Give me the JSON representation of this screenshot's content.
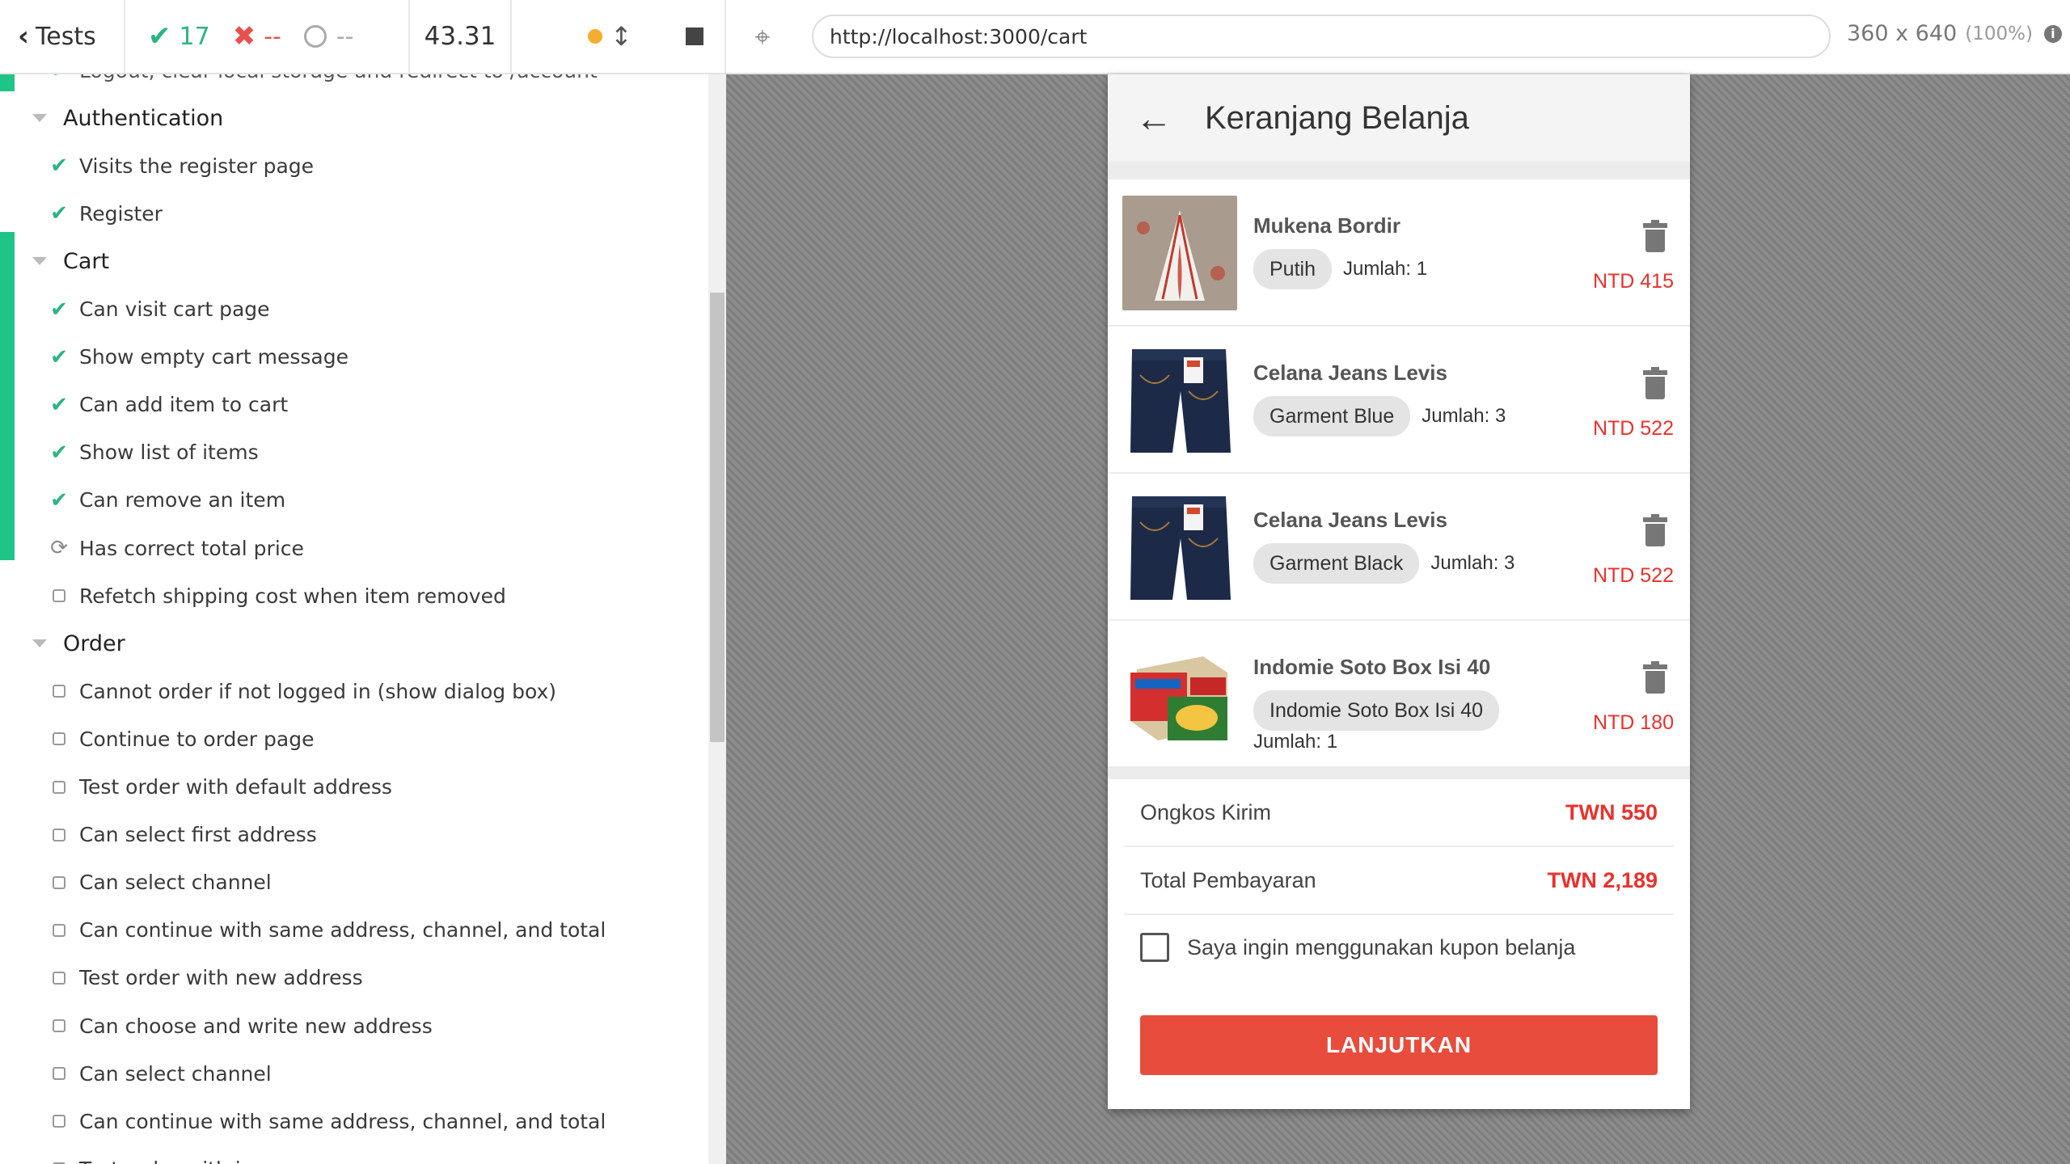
{
  "toolbar": {
    "tests_label": "Tests",
    "passed_count": "17",
    "failed_count": "--",
    "pending_count": "--",
    "duration": "43.31",
    "url": "http://localhost:3000/cart",
    "viewport_size": "360 x 640",
    "viewport_scale": "(100%)"
  },
  "reporter": {
    "rows": [
      {
        "kind": "test",
        "state": "passed",
        "label": "Logout, clear local storage and redirect to /account"
      },
      {
        "kind": "suite",
        "label": "Authentication"
      },
      {
        "kind": "test",
        "state": "passed",
        "label": "Visits the register page"
      },
      {
        "kind": "test",
        "state": "passed",
        "label": "Register"
      },
      {
        "kind": "suite",
        "label": "Cart"
      },
      {
        "kind": "test",
        "state": "passed",
        "label": "Can visit cart page"
      },
      {
        "kind": "test",
        "state": "passed",
        "label": "Show empty cart message"
      },
      {
        "kind": "test",
        "state": "passed",
        "label": "Can add item to cart"
      },
      {
        "kind": "test",
        "state": "passed",
        "label": "Show list of items"
      },
      {
        "kind": "test",
        "state": "passed",
        "label": "Can remove an item"
      },
      {
        "kind": "test",
        "state": "running",
        "label": "Has correct total price"
      },
      {
        "kind": "test",
        "state": "pending",
        "label": "Refetch shipping cost when item removed"
      },
      {
        "kind": "suite",
        "label": "Order"
      },
      {
        "kind": "test",
        "state": "pending",
        "label": "Cannot order if not logged in (show dialog box)"
      },
      {
        "kind": "test",
        "state": "pending",
        "label": "Continue to order page"
      },
      {
        "kind": "test",
        "state": "pending",
        "label": "Test order with default address"
      },
      {
        "kind": "test",
        "state": "pending",
        "label": "Can select first address"
      },
      {
        "kind": "test",
        "state": "pending",
        "label": "Can select channel"
      },
      {
        "kind": "test",
        "state": "pending",
        "label": "Can continue with same address, channel, and total"
      },
      {
        "kind": "test",
        "state": "pending",
        "label": "Test order with new address"
      },
      {
        "kind": "test",
        "state": "pending",
        "label": "Can choose and write new address"
      },
      {
        "kind": "test",
        "state": "pending",
        "label": "Can select channel"
      },
      {
        "kind": "test",
        "state": "pending",
        "label": "Can continue with same address, channel, and total"
      },
      {
        "kind": "test",
        "state": "pending",
        "label": "Test order with image"
      }
    ]
  },
  "app": {
    "title": "Keranjang Belanja",
    "items": [
      {
        "name": "Mukena Bordir",
        "variant": "Putih",
        "qty": "Jumlah: 1",
        "price": "NTD 415",
        "thumb": "mukena"
      },
      {
        "name": "Celana Jeans Levis",
        "variant": "Garment Blue",
        "qty": "Jumlah: 3",
        "price": "NTD 522",
        "thumb": "jeans"
      },
      {
        "name": "Celana Jeans Levis",
        "variant": "Garment Black",
        "qty": "Jumlah: 3",
        "price": "NTD 522",
        "thumb": "jeans"
      },
      {
        "name": "Indomie Soto Box Isi 40",
        "variant": "Indomie Soto Box Isi 40",
        "qty": "Jumlah: 1",
        "price": "NTD 180",
        "thumb": "indomie"
      }
    ],
    "shipping_label": "Ongkos Kirim",
    "shipping_value": "TWN 550",
    "total_label": "Total Pembayaran",
    "total_value": "TWN 2,189",
    "coupon_label": "Saya ingin menggunakan kupon belanja",
    "continue_label": "LANJUTKAN"
  },
  "colors": {
    "pass": "#2ab67f",
    "fail": "#e94f4f",
    "accent": "#e74c3c",
    "price": "#e8322c"
  }
}
